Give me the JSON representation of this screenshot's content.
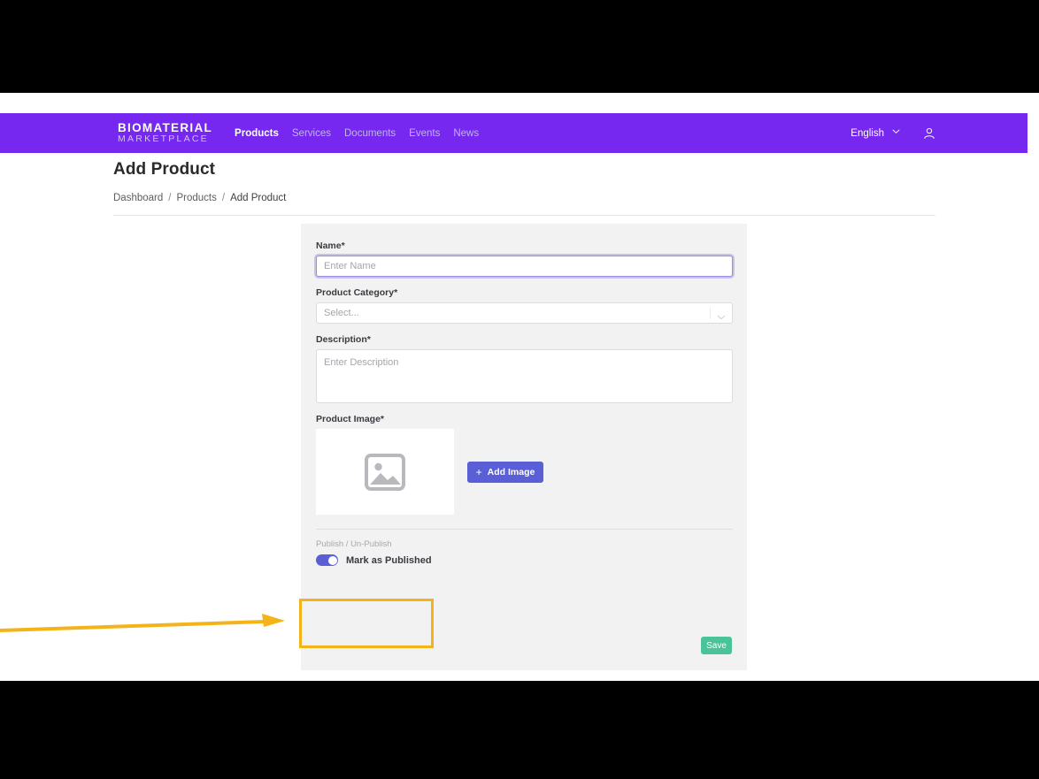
{
  "navbar": {
    "brand_line1": "BIOMATERIAL",
    "brand_line2": "MARKETPLACE",
    "links": [
      {
        "label": "Products",
        "active": true
      },
      {
        "label": "Services",
        "active": false
      },
      {
        "label": "Documents",
        "active": false
      },
      {
        "label": "Events",
        "active": false
      },
      {
        "label": "News",
        "active": false
      }
    ],
    "language": "English",
    "caret_icon": "chevron-down-icon",
    "user_icon": "user-account-icon",
    "background_color": "#7628f0"
  },
  "page": {
    "title": "Add Product",
    "breadcrumb": [
      {
        "label": "Dashboard",
        "current": false
      },
      {
        "label": "Products",
        "current": false
      },
      {
        "label": "Add Product",
        "current": true
      }
    ],
    "breadcrumb_separator": "/"
  },
  "form": {
    "name": {
      "label": "Name*",
      "placeholder": "Enter Name",
      "value": "",
      "focused": true
    },
    "category": {
      "label": "Product Category*",
      "placeholder": "Select...",
      "value": "",
      "caret_icon": "chevron-down-icon"
    },
    "description": {
      "label": "Description*",
      "placeholder": "Enter Description",
      "value": ""
    },
    "product_image": {
      "label": "Product Image*",
      "placeholder_icon": "image-placeholder-icon",
      "add_button_label": "Add Image",
      "add_button_plus": "+",
      "add_button_color": "#5b5fd6"
    },
    "publish": {
      "caption": "Publish / Un-Publish",
      "toggle_label": "Mark as Published",
      "toggle_on": true,
      "toggle_color": "#5b5fd6"
    },
    "save_label": "Save",
    "save_color": "#4ac398"
  },
  "annotation": {
    "color": "#f5b31a",
    "shape": "arrow-and-box",
    "target": "publish-toggle"
  }
}
